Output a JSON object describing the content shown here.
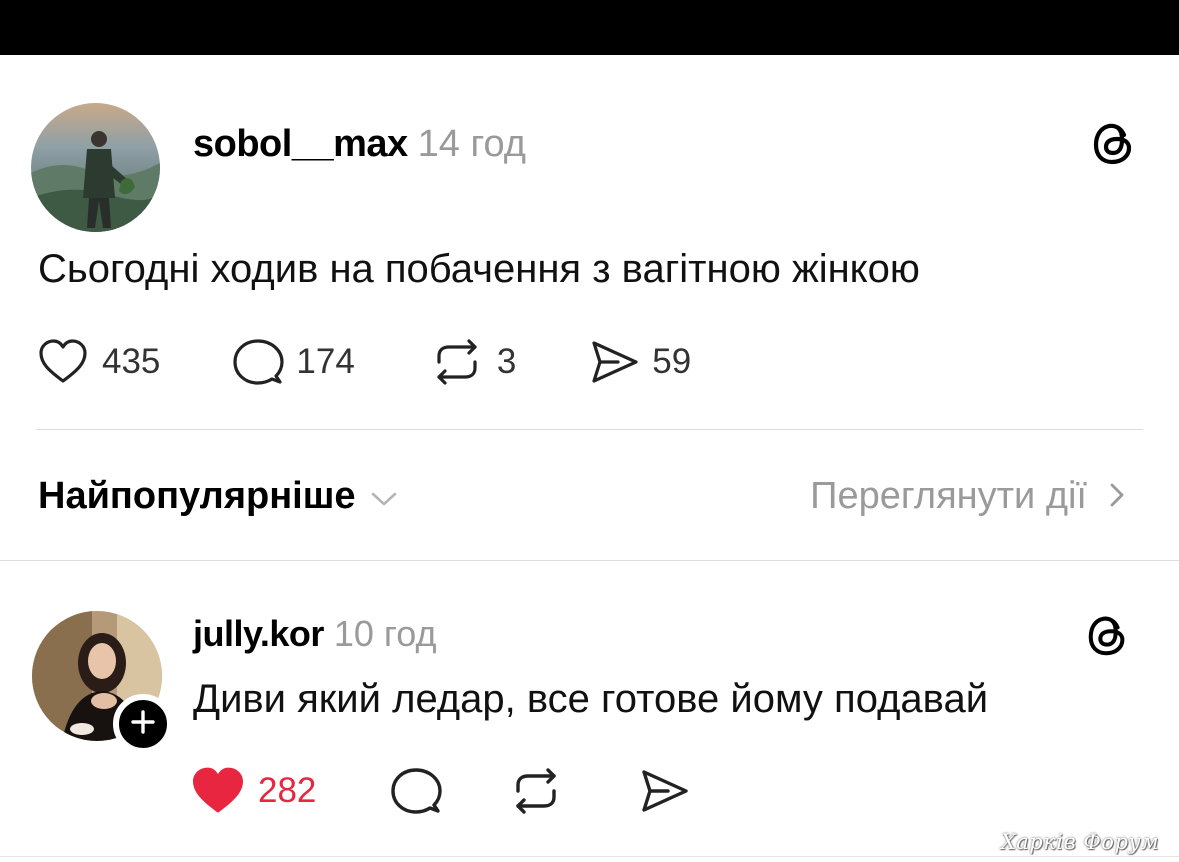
{
  "colors": {
    "accent_like": "#e8263f",
    "muted_text": "#9a9a9a",
    "divider": "#dcdcdc"
  },
  "post": {
    "username": "sobol__max",
    "time": "14 год",
    "text": "Сьогодні ходив на побачення з вагітною жінкою",
    "likes": "435",
    "comments": "174",
    "reposts": "3",
    "shares": "59",
    "icons": [
      "heart-icon",
      "comment-icon",
      "repost-icon",
      "share-icon",
      "threads-logo-icon"
    ]
  },
  "sort": {
    "label": "Найпопулярніше",
    "view_activity": "Переглянути дії"
  },
  "reply": {
    "username": "jully.kor",
    "time": "10 год",
    "text": "Диви який ледар, все готове йому подавай",
    "likes": "282",
    "liked": true
  },
  "watermark": "Харків Форум"
}
